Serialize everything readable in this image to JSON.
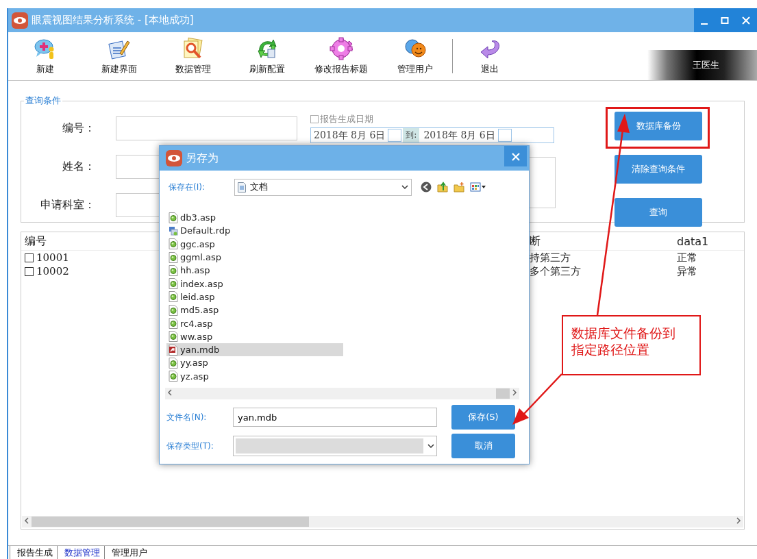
{
  "window": {
    "title": "眼震视图结果分析系统 - [本地成功]",
    "user": "王医生"
  },
  "toolbar": [
    {
      "label": "新建",
      "separator_before": false
    },
    {
      "label": "新建界面",
      "separator_before": false
    },
    {
      "label": "数据管理",
      "separator_before": false
    },
    {
      "label": "刷新配置",
      "separator_before": false
    },
    {
      "label": "修改报告标题",
      "separator_before": false
    },
    {
      "label": "管理用户",
      "separator_before": false
    },
    {
      "label": "退出",
      "separator_before": true
    }
  ],
  "query": {
    "legend": "查询条件",
    "fields": [
      {
        "label": "编号："
      },
      {
        "label": "姓名："
      },
      {
        "label": "申请科室："
      }
    ],
    "date_filter": {
      "label": "报告生成日期",
      "checked": false,
      "from": "2018年 8月 6日",
      "to_label": "到:",
      "to": "2018年 8月 6日"
    },
    "buttons": [
      {
        "label": "数据库备份",
        "highlighted": true
      },
      {
        "label": "清除查询条件",
        "highlighted": false
      },
      {
        "label": "查询",
        "highlighted": false
      }
    ]
  },
  "table": {
    "columns": [
      "编号",
      "断",
      "data1"
    ],
    "rows": [
      {
        "checked": false,
        "cells": [
          "10001",
          "持第三方",
          "正常"
        ]
      },
      {
        "checked": false,
        "cells": [
          "10002",
          "多个第三方",
          "异常"
        ]
      }
    ]
  },
  "tabs": [
    {
      "label": "报告生成",
      "selected": false
    },
    {
      "label": "数据管理",
      "selected": true
    },
    {
      "label": "管理用户",
      "selected": false
    }
  ],
  "dialog": {
    "title": "另存为",
    "location_label": "保存在(I):",
    "location": "文档",
    "files": [
      {
        "name": "db3.asp",
        "kind": "asp",
        "selected": false
      },
      {
        "name": "Default.rdp",
        "kind": "rdp",
        "selected": false
      },
      {
        "name": "ggc.asp",
        "kind": "asp",
        "selected": false
      },
      {
        "name": "ggml.asp",
        "kind": "asp",
        "selected": false
      },
      {
        "name": "hh.asp",
        "kind": "asp",
        "selected": false
      },
      {
        "name": "index.asp",
        "kind": "asp",
        "selected": false
      },
      {
        "name": "leid.asp",
        "kind": "asp",
        "selected": false
      },
      {
        "name": "md5.asp",
        "kind": "asp",
        "selected": false
      },
      {
        "name": "rc4.asp",
        "kind": "asp",
        "selected": false
      },
      {
        "name": "ww.asp",
        "kind": "asp",
        "selected": false
      },
      {
        "name": "yan.mdb",
        "kind": "mdb",
        "selected": true
      },
      {
        "name": "yy.asp",
        "kind": "asp",
        "selected": false
      },
      {
        "name": "yz.asp",
        "kind": "asp",
        "selected": false
      }
    ],
    "filename_label": "文件名(N):",
    "filename": "yan.mdb",
    "type_label": "保存类型(T):",
    "save": "保存(S)",
    "cancel": "取消"
  },
  "annotation": {
    "lines": [
      "数据库文件备份到",
      "指定路径位置"
    ]
  }
}
